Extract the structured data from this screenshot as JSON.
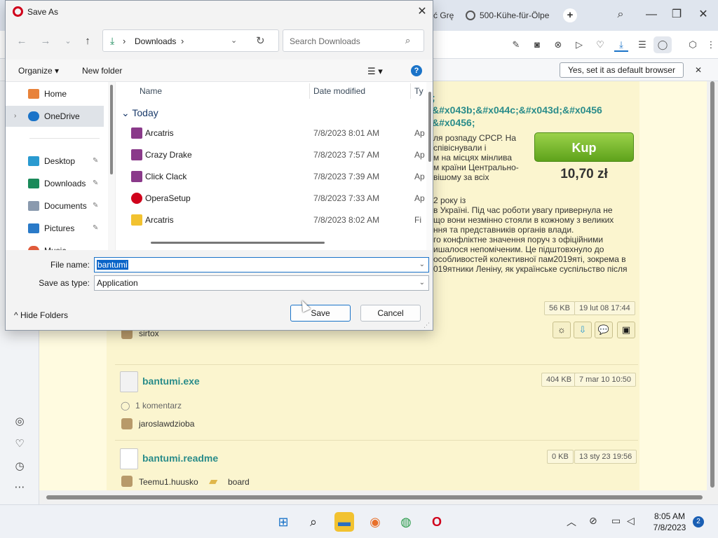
{
  "browser": {
    "tabs": [
      {
        "label": "ć Grę"
      },
      {
        "label": "500-Kühe-für-Ölpe"
      }
    ],
    "infobar": {
      "default_button": "Yes, set it as default browser"
    }
  },
  "page": {
    "entity_lines": [
      ";",
      "&#x043b;&#x044c;&#x043d;&#x0456",
      "&#x0456;"
    ],
    "intro_lines": [
      "ля розпаду СРСР. На",
      "співіснували і",
      "м на місцях мінлива",
      "м країни Центрально-",
      "вішому за всіх"
    ],
    "body_lines": [
      "2 року із",
      "в Україні. Під час роботи увагу привернула не",
      "що вони незмінно стояли в кожному з великих",
      "ння та представників органів влади.",
      "го конфліктне значення поруч з офіційними",
      "ишалося непоміченим. Це підштовхнуло до",
      "особливостей колективної пам2019яті, зокрема в",
      "019ятники Леніну, як українське суспільство після"
    ],
    "buy_label": "Kup",
    "price": "10,70 zł",
    "files": [
      {
        "name": "",
        "size": "56 KB",
        "date": "19 lut 08 17:44",
        "user": "sirtox"
      },
      {
        "name": "bantumi.exe",
        "size": "404 KB",
        "date": "7 mar 10 10:50",
        "comments": "1 komentarz",
        "user": "jaroslawdzioba"
      },
      {
        "name": "bantumi.readme",
        "size": "0 KB",
        "date": "13 sty 23 19:56",
        "user": "Teemu1.huusko",
        "folder": "board"
      }
    ]
  },
  "dialog": {
    "title": "Save As",
    "address_crumb": "Downloads",
    "search_placeholder": "Search Downloads",
    "commands": {
      "organize": "Organize",
      "new_folder": "New folder"
    },
    "nav": [
      {
        "label": "Home",
        "icon": "home-icon"
      },
      {
        "label": "OneDrive",
        "icon": "cloud-icon"
      },
      {
        "label": "Desktop",
        "icon": "desktop-icon"
      },
      {
        "label": "Downloads",
        "icon": "download-icon"
      },
      {
        "label": "Documents",
        "icon": "document-icon"
      },
      {
        "label": "Pictures",
        "icon": "picture-icon"
      },
      {
        "label": "Music",
        "icon": "music-icon"
      }
    ],
    "columns": {
      "name": "Name",
      "date": "Date modified",
      "type": "Ty"
    },
    "group": "Today",
    "files": [
      {
        "name": "Arcatris",
        "date": "7/8/2023 8:01 AM",
        "type": "Ap"
      },
      {
        "name": "Crazy Drake",
        "date": "7/8/2023 7:57 AM",
        "type": "Ap"
      },
      {
        "name": "Click Clack",
        "date": "7/8/2023 7:39 AM",
        "type": "Ap"
      },
      {
        "name": "OperaSetup",
        "date": "7/8/2023 7:33 AM",
        "type": "Ap"
      },
      {
        "name": "Arcatris",
        "date": "7/8/2023 8:02 AM",
        "type": "Fi"
      }
    ],
    "file_name_label": "File name:",
    "file_name_value": "bantumi",
    "save_type_label": "Save as type:",
    "save_type_value": "Application",
    "hide_folders": "Hide Folders",
    "save_button": "Save",
    "cancel_button": "Cancel"
  },
  "taskbar": {
    "time": "8:05 AM",
    "date": "7/8/2023",
    "notification_count": "2"
  }
}
